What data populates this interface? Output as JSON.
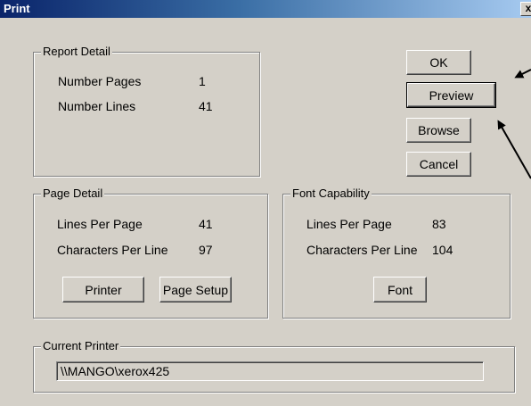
{
  "window": {
    "title": "Print",
    "close_label": "x"
  },
  "report_detail": {
    "legend": "Report Detail",
    "number_pages_label": "Number Pages",
    "number_pages_value": "1",
    "number_lines_label": "Number Lines",
    "number_lines_value": "41"
  },
  "buttons": {
    "ok": "OK",
    "preview": "Preview",
    "browse": "Browse",
    "cancel": "Cancel"
  },
  "page_detail": {
    "legend": "Page Detail",
    "lines_label": "Lines Per Page",
    "lines_value": "41",
    "chars_label": "Characters Per Line",
    "chars_value": "97",
    "printer_button": "Printer",
    "page_setup_button": "Page Setup"
  },
  "font_capability": {
    "legend": "Font Capability",
    "lines_label": "Lines Per Page",
    "lines_value": "83",
    "chars_label": "Characters Per Line",
    "chars_value": "104",
    "font_button": "Font"
  },
  "current_printer": {
    "legend": "Current Printer",
    "value": "\\\\MANGO\\xerox425"
  },
  "icons": {
    "close": "close-icon",
    "annotation_arrows": "arrow-icon"
  }
}
